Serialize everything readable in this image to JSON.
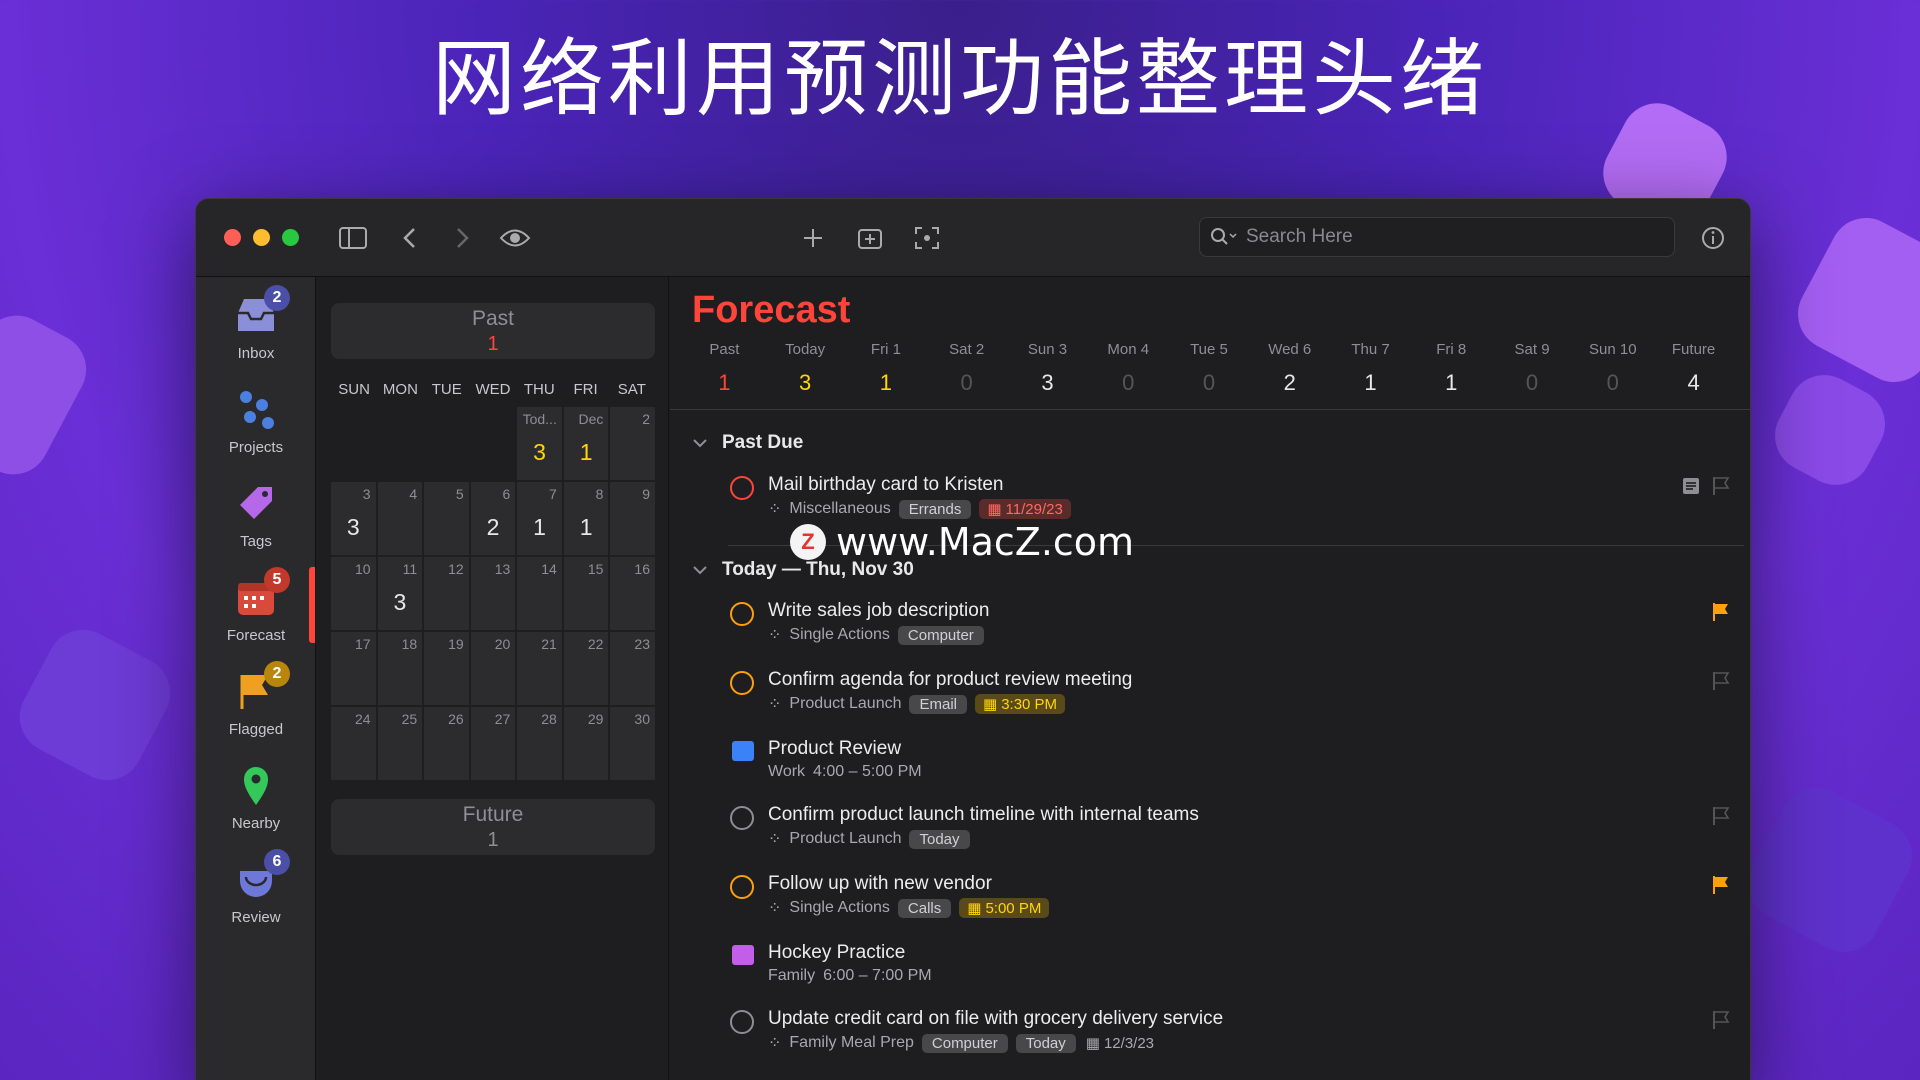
{
  "headline": "网络利用预测功能整理头绪",
  "watermark": {
    "logo_letter": "Z",
    "text": "www.MacZ.com"
  },
  "search": {
    "placeholder": "Search Here"
  },
  "sidebar": {
    "items": [
      {
        "label": "Inbox",
        "badge": "2",
        "icon": "inbox-icon",
        "badge_color": "#4b4fa8"
      },
      {
        "label": "Projects",
        "badge": "",
        "icon": "projects-icon"
      },
      {
        "label": "Tags",
        "badge": "",
        "icon": "tag-icon"
      },
      {
        "label": "Forecast",
        "badge": "5",
        "icon": "forecast-icon",
        "badge_color": "#c0392b"
      },
      {
        "label": "Flagged",
        "badge": "2",
        "icon": "flag-icon",
        "badge_color": "#b8860b"
      },
      {
        "label": "Nearby",
        "badge": "",
        "icon": "location-pin-icon"
      },
      {
        "label": "Review",
        "badge": "6",
        "icon": "review-icon",
        "badge_color": "#4b4fa8"
      }
    ]
  },
  "calendar": {
    "past": {
      "label": "Past",
      "count": "1"
    },
    "future": {
      "label": "Future",
      "count": "1"
    },
    "dow": [
      "SUN",
      "MON",
      "TUE",
      "WED",
      "THU",
      "FRI",
      "SAT"
    ],
    "cells": [
      {
        "d": "",
        "c": "",
        "empty": true
      },
      {
        "d": "",
        "c": "",
        "empty": true
      },
      {
        "d": "",
        "c": "",
        "empty": true
      },
      {
        "d": "",
        "c": "",
        "empty": true
      },
      {
        "d": "Tod...",
        "c": "3",
        "y": true
      },
      {
        "d": "Dec",
        "c": "1",
        "y": true
      },
      {
        "d": "2",
        "c": ""
      },
      {
        "d": "3",
        "c": "3"
      },
      {
        "d": "4",
        "c": ""
      },
      {
        "d": "5",
        "c": ""
      },
      {
        "d": "6",
        "c": "2"
      },
      {
        "d": "7",
        "c": "1"
      },
      {
        "d": "8",
        "c": "1"
      },
      {
        "d": "9",
        "c": ""
      },
      {
        "d": "10",
        "c": ""
      },
      {
        "d": "11",
        "c": "3"
      },
      {
        "d": "12",
        "c": ""
      },
      {
        "d": "13",
        "c": ""
      },
      {
        "d": "14",
        "c": ""
      },
      {
        "d": "15",
        "c": ""
      },
      {
        "d": "16",
        "c": ""
      },
      {
        "d": "17",
        "c": ""
      },
      {
        "d": "18",
        "c": ""
      },
      {
        "d": "19",
        "c": ""
      },
      {
        "d": "20",
        "c": ""
      },
      {
        "d": "21",
        "c": ""
      },
      {
        "d": "22",
        "c": ""
      },
      {
        "d": "23",
        "c": ""
      },
      {
        "d": "24",
        "c": ""
      },
      {
        "d": "25",
        "c": ""
      },
      {
        "d": "26",
        "c": ""
      },
      {
        "d": "27",
        "c": ""
      },
      {
        "d": "28",
        "c": ""
      },
      {
        "d": "29",
        "c": ""
      },
      {
        "d": "30",
        "c": ""
      }
    ]
  },
  "forecast": {
    "title": "Forecast",
    "strip": [
      {
        "label": "Past",
        "value": "1",
        "style": "red"
      },
      {
        "label": "Today",
        "value": "3",
        "style": "yel"
      },
      {
        "label": "Fri 1",
        "value": "1",
        "style": "yel"
      },
      {
        "label": "Sat 2",
        "value": "0",
        "style": "zero"
      },
      {
        "label": "Sun 3",
        "value": "3",
        "style": ""
      },
      {
        "label": "Mon 4",
        "value": "0",
        "style": "zero"
      },
      {
        "label": "Tue 5",
        "value": "0",
        "style": "zero"
      },
      {
        "label": "Wed 6",
        "value": "2",
        "style": ""
      },
      {
        "label": "Thu 7",
        "value": "1",
        "style": ""
      },
      {
        "label": "Fri 8",
        "value": "1",
        "style": ""
      },
      {
        "label": "Sat 9",
        "value": "0",
        "style": "zero"
      },
      {
        "label": "Sun 10",
        "value": "0",
        "style": "zero"
      },
      {
        "label": "Future",
        "value": "4",
        "style": ""
      }
    ],
    "sections": {
      "past_due": "Past Due",
      "today": "Today — Thu, Nov 30"
    },
    "tasks": [
      {
        "title": "Mail birthday card to Kristen",
        "project": "Miscellaneous",
        "tags": [
          "Errands"
        ],
        "due": "11/29/23"
      },
      {
        "title": "Write sales job description",
        "project": "Single Actions",
        "tags": [
          "Computer"
        ]
      },
      {
        "title": "Confirm agenda for product review meeting",
        "project": "Product Launch",
        "tags": [
          "Email"
        ],
        "due": "3:30 PM"
      },
      {
        "title": "Product Review",
        "calendar": "Work",
        "time": "4:00 – 5:00 PM"
      },
      {
        "title": "Confirm product launch timeline with internal teams",
        "project": "Product Launch",
        "tags": [
          "Today"
        ]
      },
      {
        "title": "Follow up with new vendor",
        "project": "Single Actions",
        "tags": [
          "Calls"
        ],
        "due": "5:00 PM"
      },
      {
        "title": "Hockey Practice",
        "calendar": "Family",
        "time": "6:00 – 7:00 PM"
      },
      {
        "title": "Update credit card on file with grocery delivery service",
        "project": "Family Meal Prep",
        "tags": [
          "Computer",
          "Today"
        ],
        "due": "12/3/23"
      }
    ]
  },
  "colors": {
    "accent_red": "#ff453a",
    "accent_yellow": "#ffd60a",
    "accent_orange": "#ff9f0a"
  }
}
